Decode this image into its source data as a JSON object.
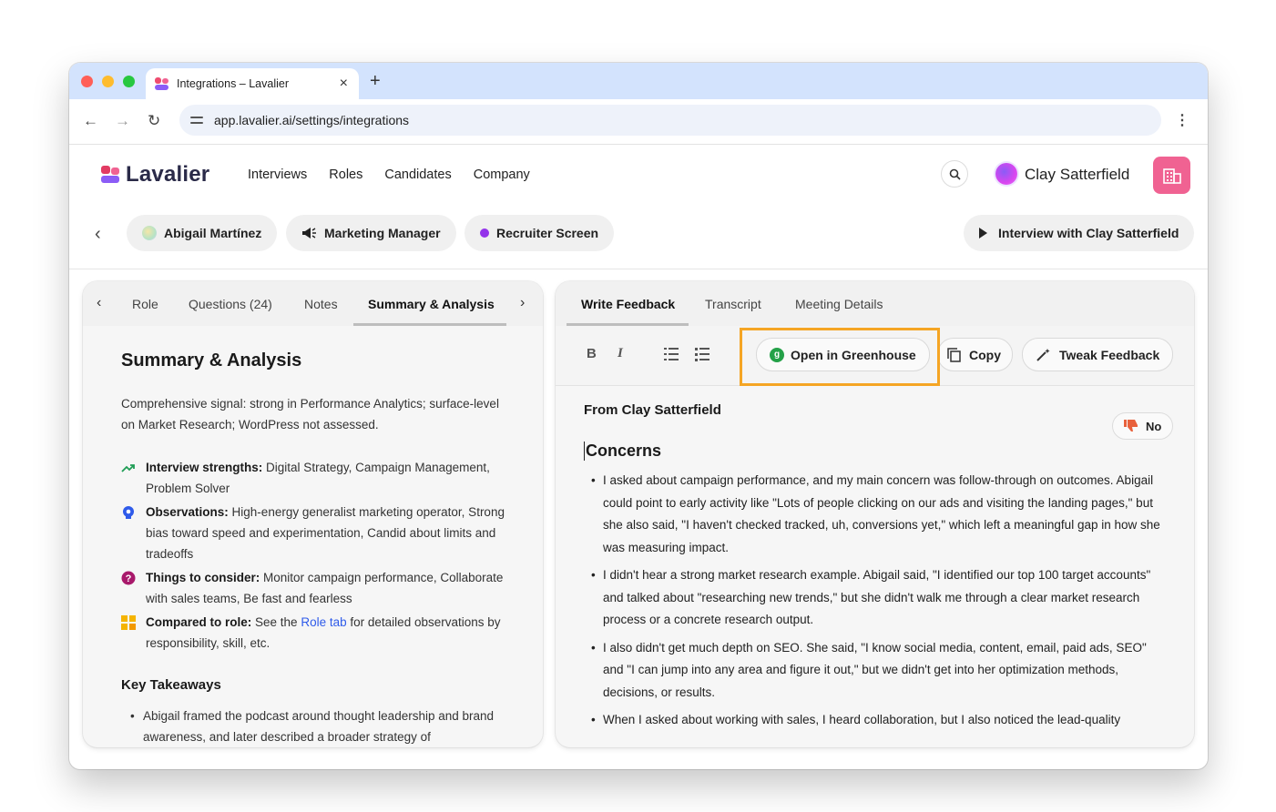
{
  "browser": {
    "tab_title": "Integrations – Lavalier",
    "url": "app.lavalier.ai/settings/integrations",
    "new_tab": "+",
    "close": "×"
  },
  "app": {
    "brand": "Lavalier",
    "nav": [
      "Interviews",
      "Roles",
      "Candidates",
      "Company"
    ],
    "user_name": "Clay Satterfield"
  },
  "context": {
    "candidate": "Abigail Martínez",
    "role": "Marketing Manager",
    "stage": "Recruiter Screen",
    "interview": "Interview with Clay Satterfield"
  },
  "left_panel": {
    "tabs": [
      "Role",
      "Questions (24)",
      "Notes",
      "Summary & Analysis"
    ],
    "active_tab": "Summary & Analysis",
    "heading": "Summary & Analysis",
    "summary": "Comprehensive signal: strong in Performance Analytics; surface-level on Market Research; WordPress not assessed.",
    "strengths_label": "Interview strengths:",
    "strengths_text": "Digital Strategy, Campaign Management, Problem Solver",
    "observations_label": "Observations:",
    "observations_text": "High-energy generalist marketing operator, Strong bias toward speed and experimentation, Candid about limits and tradeoffs",
    "consider_label": "Things to consider:",
    "consider_text": "Monitor campaign performance, Collaborate with sales teams, Be fast and fearless",
    "compared_label": "Compared to role:",
    "compared_pre": "See the",
    "compared_link": "Role tab",
    "compared_post": "for detailed observations by responsibility, skill, etc.",
    "key_takeaways_heading": "Key Takeaways",
    "key_takeaways": [
      "Abigail framed the podcast around thought leadership and brand awareness, and later described a broader strategy of"
    ]
  },
  "right_panel": {
    "tabs": [
      "Write Feedback",
      "Transcript",
      "Meeting Details"
    ],
    "active_tab": "Write Feedback",
    "toolbar": {
      "bold": "B",
      "italic": "I",
      "open_greenhouse": "Open in Greenhouse",
      "greenhouse_badge": "g",
      "copy": "Copy",
      "tweak": "Tweak Feedback"
    },
    "from": "From Clay Satterfield",
    "vote": "No",
    "section_heading": "Concerns",
    "concerns": [
      "I asked about campaign performance, and my main concern was follow-through on outcomes. Abigail could point to early activity like \"Lots of people clicking on our ads and visiting the landing pages,\" but she also said, \"I haven't checked tracked, uh, conversions yet,\" which left a meaningful gap in how she was measuring impact.",
      "I didn't hear a strong market research example. Abigail said, \"I identified our top 100 target accounts\" and talked about \"researching new trends,\" but she didn't walk me through a clear market research process or a concrete research output.",
      "I also didn't get much depth on SEO. She said, \"I know social media, content, email, paid ads, SEO\" and \"I can jump into any area and figure it out,\" but we didn't get into her optimization methods, decisions, or results.",
      "When I asked about working with sales, I heard collaboration, but I also noticed the lead-quality"
    ]
  },
  "colors": {
    "tabstrip": "#d3e3fd",
    "company_button": "#f06292",
    "highlight": "#f5a524",
    "greenhouse": "#24a148",
    "link": "#2f5bea",
    "stage_dot": "#9333ea"
  }
}
